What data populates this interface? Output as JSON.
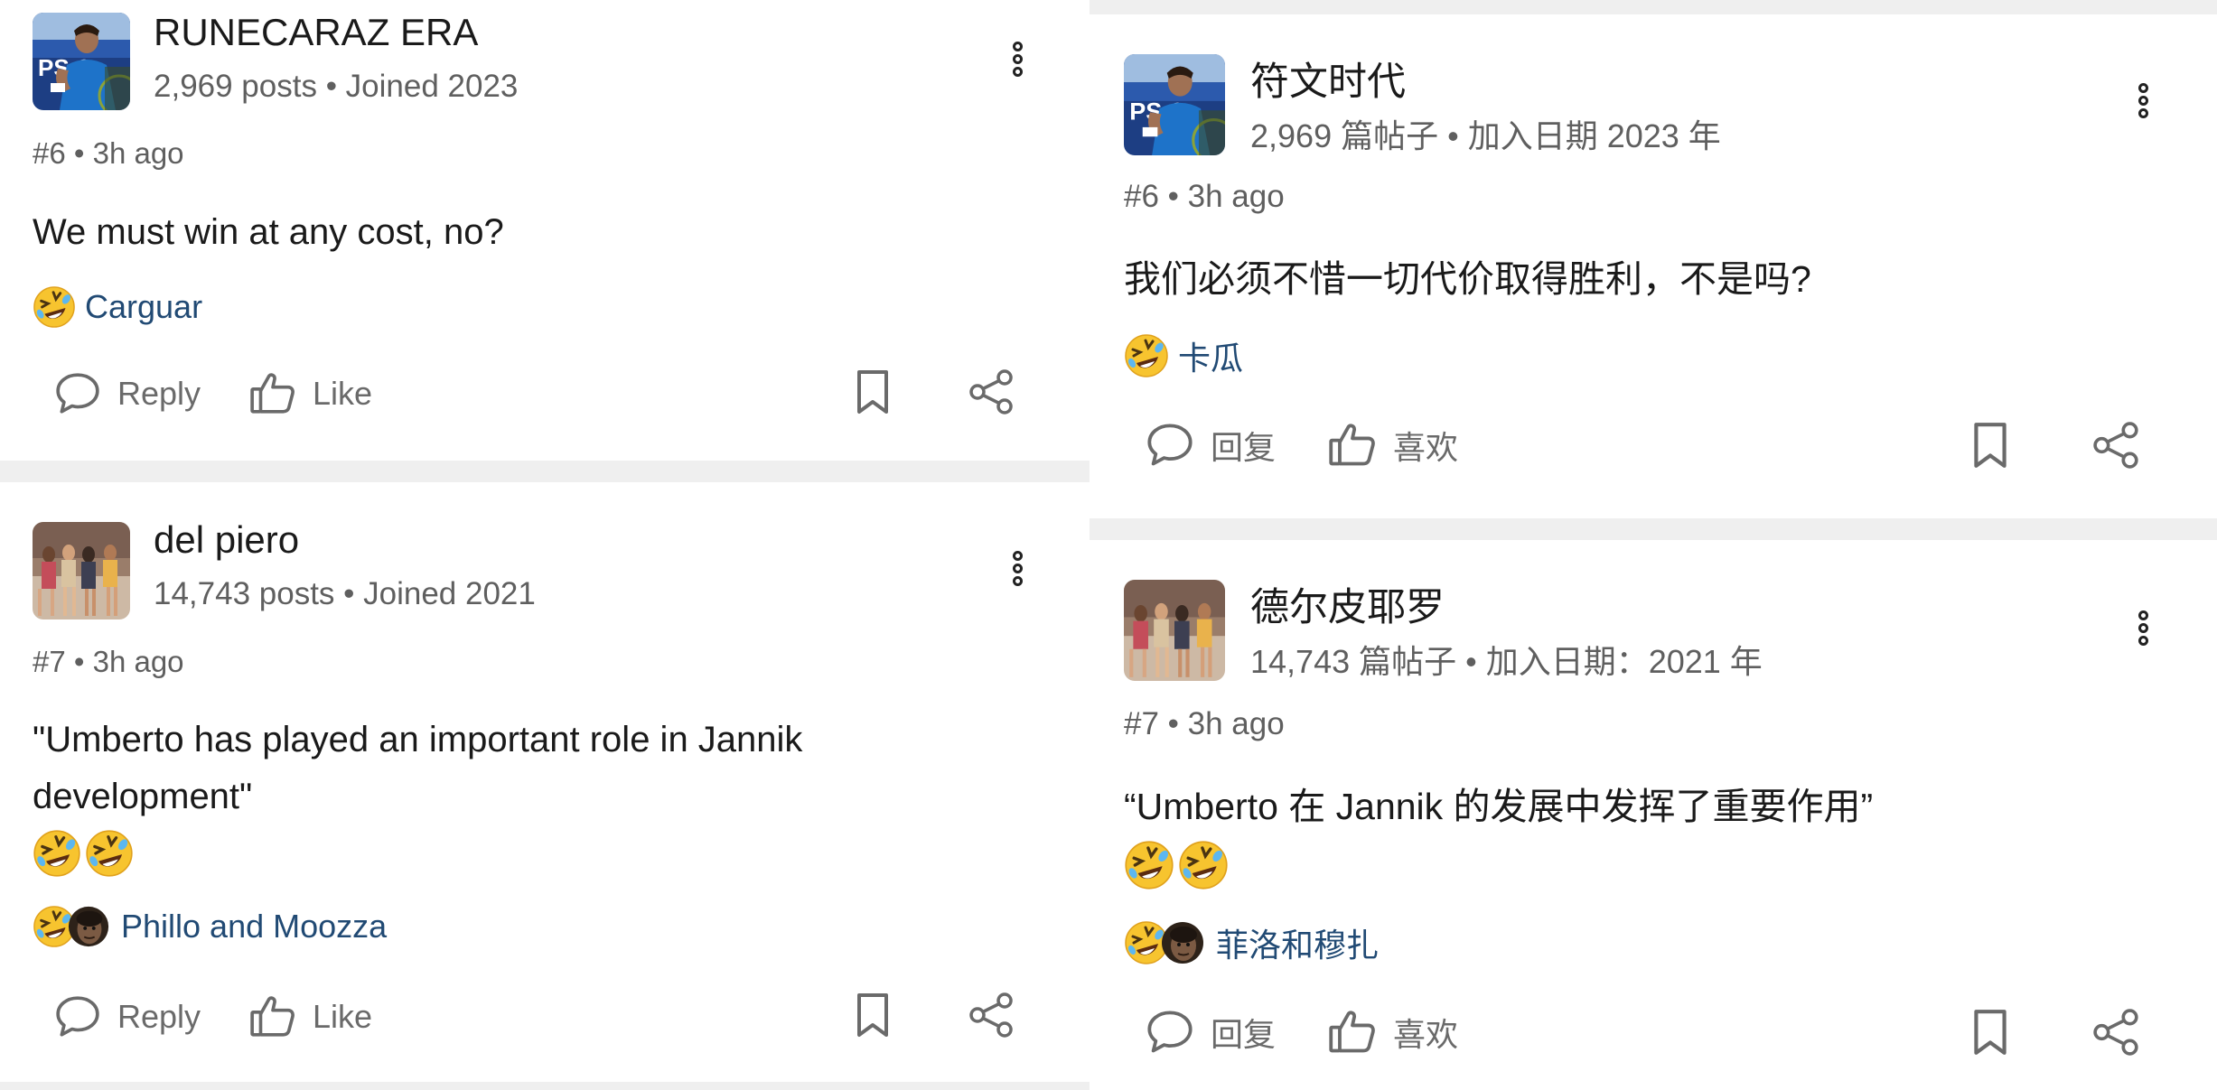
{
  "left": {
    "posts": [
      {
        "username": "RUNECARAZ ERA",
        "meta": "2,969 posts • Joined 2023",
        "post_number": "#6 • 3h ago",
        "body_lines": [
          "We must win at any cost, no?"
        ],
        "reactors": "Carguar",
        "reply_label": "Reply",
        "like_label": "Like",
        "avatar_icon": "tennis-player-avatar"
      },
      {
        "username": "del piero",
        "meta": "14,743 posts • Joined 2021",
        "post_number": "#7 • 3h ago",
        "body_lines": [
          "\"Umberto has played an important role in Jannik",
          "development\""
        ],
        "reactors": "Phillo and Moozza",
        "reply_label": "Reply",
        "like_label": "Like",
        "avatar_icon": "group-photo-avatar"
      }
    ]
  },
  "right": {
    "posts": [
      {
        "username": "符文时代",
        "meta": "2,969 篇帖子 • 加入日期 2023 年",
        "post_number": "#6 • 3h ago",
        "body_lines": [
          "我们必须不惜一切代价取得胜利，不是吗?"
        ],
        "reactors": "卡瓜",
        "reply_label": "回复",
        "like_label": "喜欢",
        "avatar_icon": "tennis-player-avatar"
      },
      {
        "username": "德尔皮耶罗",
        "meta": "14,743 篇帖子 • 加入日期：2021 年",
        "post_number": "#7 • 3h ago",
        "body_lines": [
          "“Umberto 在 Jannik 的发展中发挥了重要作用”"
        ],
        "reactors": "菲洛和穆扎",
        "reply_label": "回复",
        "like_label": "喜欢",
        "avatar_icon": "group-photo-avatar"
      }
    ]
  },
  "icons": {
    "reply": "speech-bubble-icon",
    "like": "thumbs-up-icon",
    "bookmark": "bookmark-icon",
    "share": "share-icon",
    "more": "more-vertical-icon",
    "reaction": "rolling-laughing-emoji"
  },
  "colors": {
    "reactor_link": "#214a74",
    "muted_text": "#5f5f5f",
    "separator": "#efefef"
  }
}
